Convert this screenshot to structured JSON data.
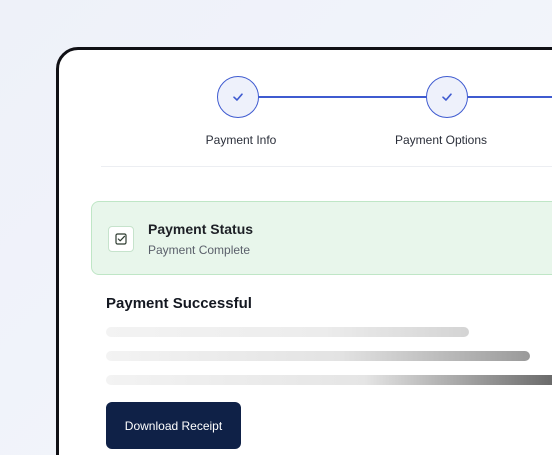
{
  "stepper": {
    "steps": [
      {
        "label": "Payment Info",
        "state": "complete",
        "icon": "check-icon"
      },
      {
        "label": "Payment Options",
        "state": "complete",
        "icon": "check-icon"
      }
    ],
    "accent_color": "#3f5bd0"
  },
  "status": {
    "title": "Payment Status",
    "subtitle": "Payment Complete",
    "icon": "checkbox-check-icon",
    "color": "#e8f6eb"
  },
  "result": {
    "title": "Payment Successful"
  },
  "actions": {
    "download_label": "Download Receipt",
    "button_color": "#0f2147"
  }
}
